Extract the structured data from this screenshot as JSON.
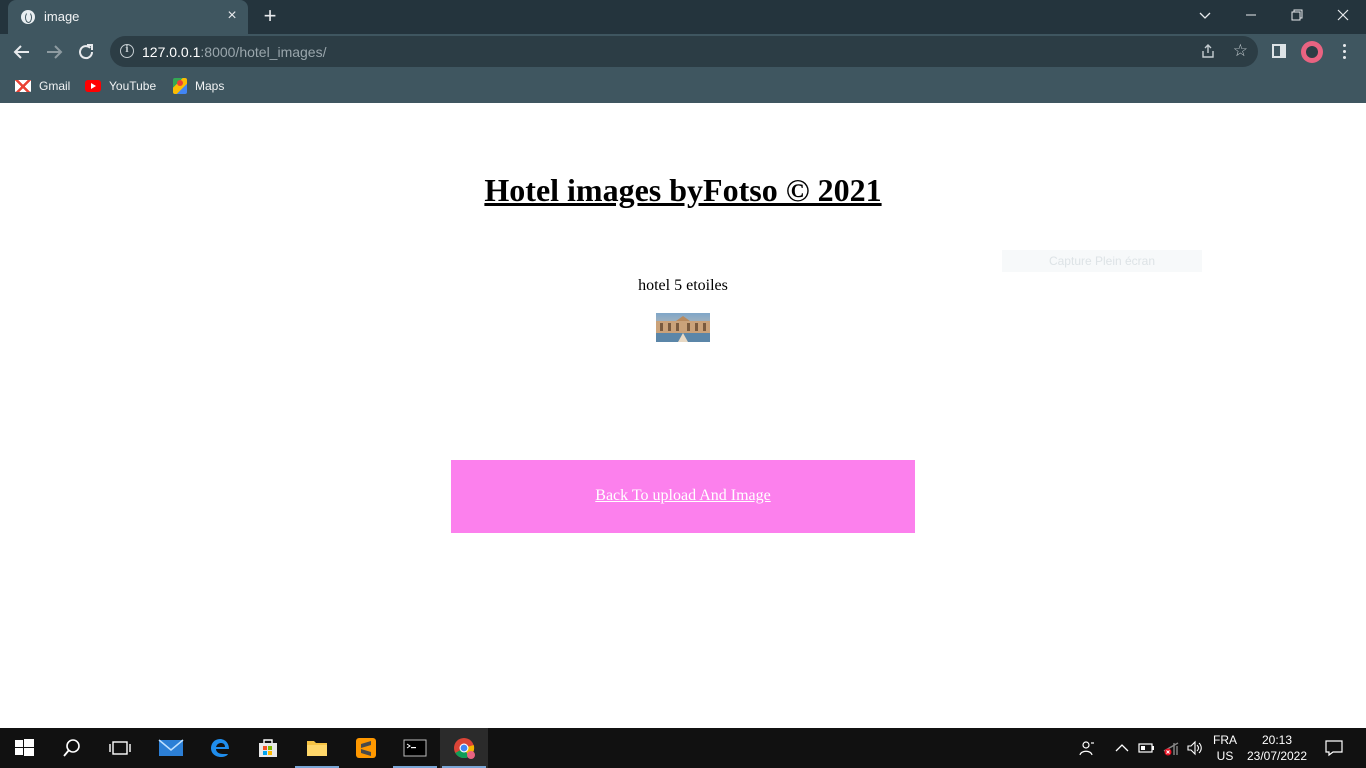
{
  "browser": {
    "tab": {
      "title": "image"
    },
    "address": {
      "host": "127.0.0.1",
      "rest": ":8000/hotel_images/"
    },
    "bookmarks": [
      {
        "label": "Gmail",
        "icon": "gmail-icon"
      },
      {
        "label": "YouTube",
        "icon": "youtube-icon"
      },
      {
        "label": "Maps",
        "icon": "maps-icon"
      }
    ]
  },
  "page": {
    "title": "Hotel images byFotso © 2021",
    "ghost_tooltip": "Capture Plein écran",
    "hotel": {
      "name": "hotel 5 etoiles",
      "thumbnail": "hotel-photo"
    },
    "back_link": "Back To upload And Image",
    "colors": {
      "back_box": "#fc80ed",
      "link_text": "#ffffff"
    }
  },
  "taskbar": {
    "language": {
      "code": "FRA",
      "layout": "US"
    },
    "clock": {
      "time": "20:13",
      "date": "23/07/2022"
    }
  }
}
